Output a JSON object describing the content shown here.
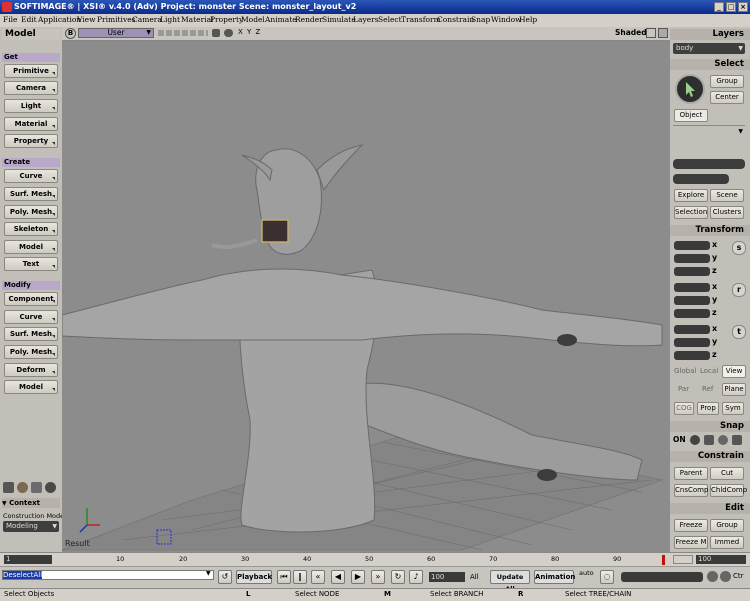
{
  "window": {
    "title": "SOFTIMAGE® | XSI® v.4.0 (Adv) Project: monster     Scene: monster_layout_v2"
  },
  "menu": [
    "File",
    "Edit",
    "Application",
    "View",
    "Primitives",
    "Camera",
    "Light",
    "Material",
    "Property",
    "Model",
    "Animate",
    "Render",
    "Simulate",
    "Layers",
    "Select",
    "Transform",
    "Constrain",
    "Snap",
    "Window",
    "Help"
  ],
  "left_panel": {
    "title": "Model",
    "get": {
      "label": "Get",
      "items": [
        "Primitive",
        "Camera",
        "Light",
        "Material",
        "Property"
      ]
    },
    "create": {
      "label": "Create",
      "items": [
        "Curve",
        "Surf. Mesh",
        "Poly. Mesh",
        "Skeleton",
        "Model",
        "Text"
      ]
    },
    "modify": {
      "label": "Modify",
      "items": [
        "Component",
        "Curve",
        "Surf. Mesh",
        "Poly. Mesh",
        "Deform",
        "Model"
      ]
    },
    "context": "Context",
    "construction_mode_label": "Construction Mode",
    "construction_mode": "Modeling"
  },
  "viewport": {
    "camera": "User",
    "axes": "X Y Z",
    "shading": "Shaded",
    "result_label": "Result",
    "badge": "B"
  },
  "right_panel": {
    "layers_title": "Layers",
    "layer_value": "body",
    "select_title": "Select",
    "group": "Group",
    "center": "Center",
    "object": "Object",
    "explore": "Explore",
    "scene": "Scene",
    "selection": "Selection",
    "clusters": "Clusters",
    "transform_title": "Transform",
    "axes": [
      "x",
      "y",
      "z"
    ],
    "transform_icons": [
      "s",
      "r",
      "t"
    ],
    "ref_global": "Global",
    "ref_local": "Local",
    "ref_view": "View",
    "par": "Par",
    "ref": "Ref",
    "plane": "Plane",
    "cog": "COG",
    "prop": "Prop",
    "sym": "Sym",
    "snap_title": "Snap",
    "snap_on": "ON",
    "constrain_title": "Constrain",
    "parent": "Parent",
    "cut": "Cut",
    "cnscomp": "CnsComp",
    "childcomp": "ChldComp",
    "edit_title": "Edit",
    "freeze": "Freeze",
    "group_edit": "Group",
    "freeze_m": "Freeze M",
    "immed": "Immed"
  },
  "timeline": {
    "start": "1",
    "end": "100",
    "end_field": "100",
    "ticks": [
      "10",
      "20",
      "30",
      "40",
      "50",
      "60",
      "70",
      "80",
      "90"
    ]
  },
  "playbar": {
    "command": "DeselectAll",
    "playback": "Playback",
    "frame": "100",
    "all": "All",
    "update_all": "Update All",
    "animation": "Animation",
    "auto": "auto",
    "ctr": "Ctr"
  },
  "status": {
    "left": "Select Objects",
    "l": "L",
    "l_action": "Select NODE",
    "m": "M",
    "m_action": "Select BRANCH",
    "r": "R",
    "r_action": "Select TREE/CHAIN"
  }
}
